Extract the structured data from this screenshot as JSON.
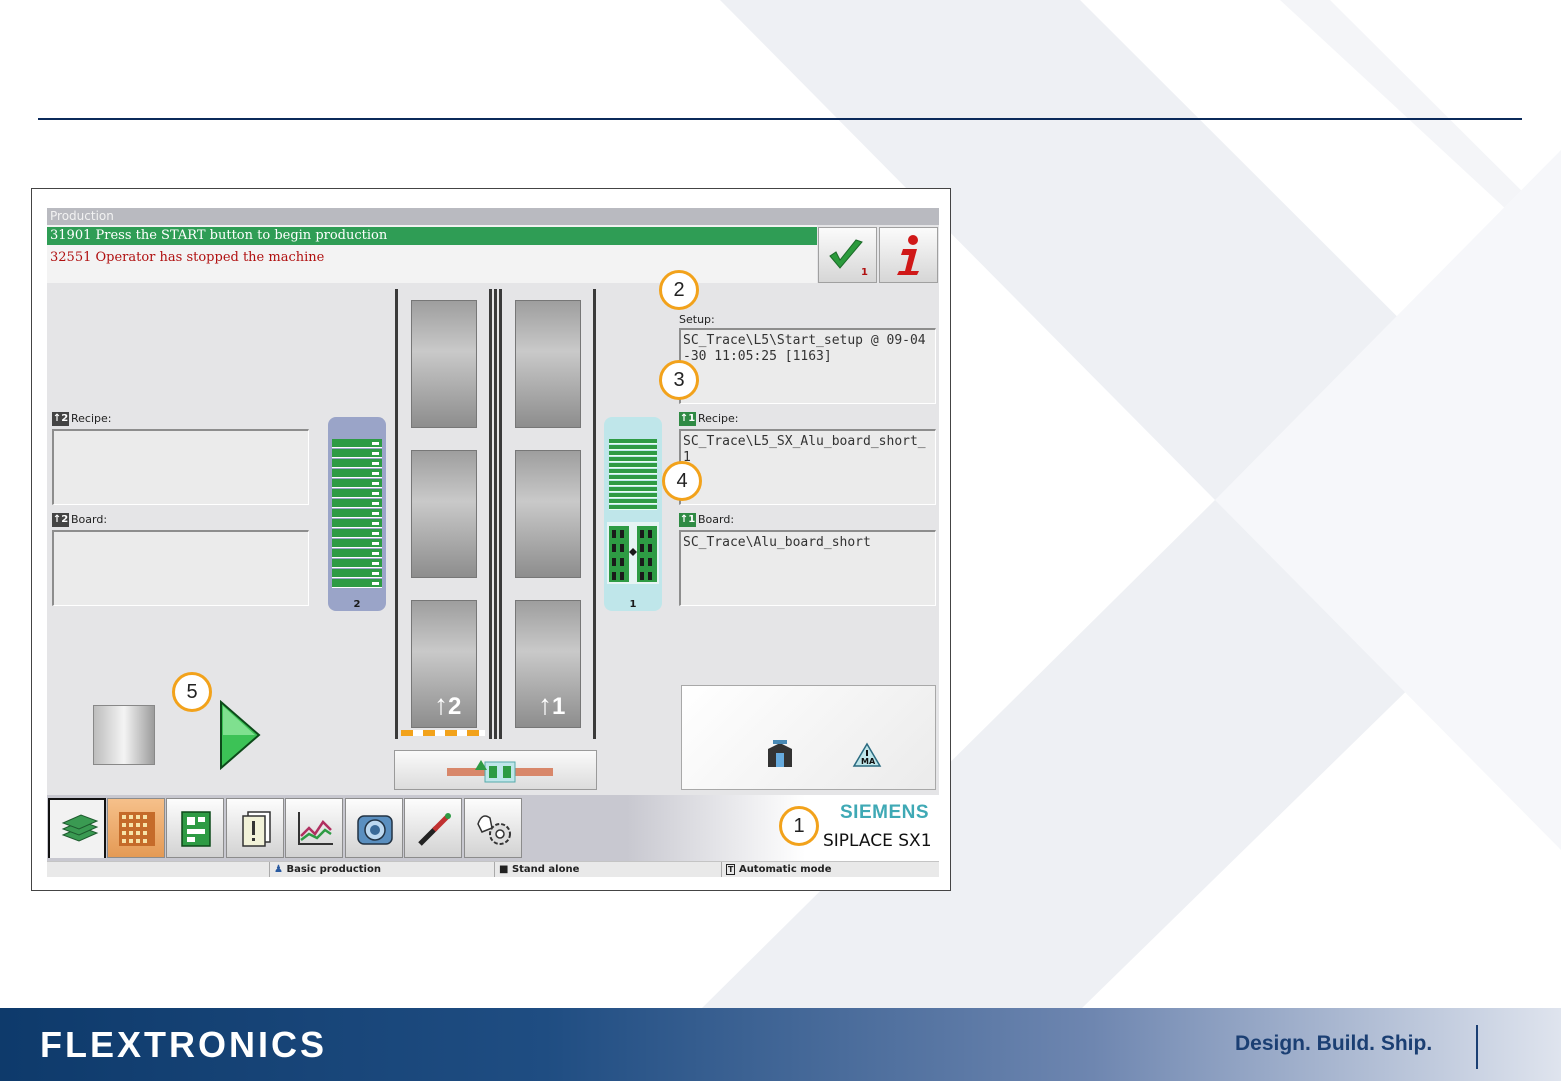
{
  "window": {
    "title": "Production"
  },
  "messages": {
    "active": "31901 Press the START button to begin production",
    "stopped": "32551 Operator has stopped the machine",
    "ack_count": "1"
  },
  "left_panel": {
    "recipe_prefix": "2",
    "recipe_label": "Recipe:",
    "recipe_value": "",
    "board_prefix": "2",
    "board_label": "Board:",
    "board_value": ""
  },
  "right_panel": {
    "setup_label": "Setup:",
    "setup_value": "SC_Trace\\L5\\Start_setup @ 09-04-30 11:05:25 [1163]",
    "recipe_prefix": "1",
    "recipe_label": "Recipe:",
    "recipe_value": "SC_Trace\\L5_SX_Alu_board_short_1",
    "board_prefix": "1",
    "board_label": "Board:",
    "board_value": "SC_Trace\\Alu_board_short"
  },
  "feeders": {
    "left_number": "2",
    "right_number": "1"
  },
  "lanes": {
    "left_number": "2",
    "right_number": "1"
  },
  "callouts": [
    "1",
    "2",
    "3",
    "4",
    "5"
  ],
  "brand": {
    "name": "SIEMENS",
    "model": "SIPLACE SX1"
  },
  "statusbar": {
    "mode": "Basic production",
    "line": "Stand alone",
    "operation": "Automatic mode"
  },
  "nav_icons": [
    "production-icon",
    "feeder-table-icon",
    "pcb-icon",
    "document-icon",
    "chart-icon",
    "camera-icon",
    "tool-icon",
    "service-settings-icon"
  ],
  "footer": {
    "logo": "FLEXTRONICS",
    "tagline": "Design. Build. Ship."
  },
  "colors": {
    "message_green": "#2f9d55",
    "error_red": "#b01010",
    "callout_orange": "#f2a21b",
    "brand_teal": "#3fa9b5",
    "footer_blue": "#0e3a6b"
  }
}
